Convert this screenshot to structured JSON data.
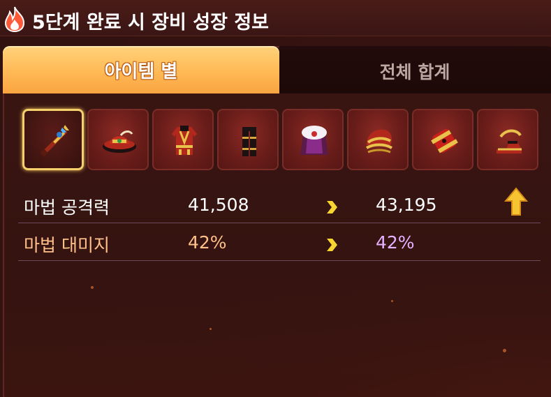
{
  "header": {
    "title": "5단계 완료 시 장비 성장 정보",
    "icon": "flame-icon"
  },
  "tabs": [
    {
      "label": "아이템 별",
      "active": true
    },
    {
      "label": "전체 합계",
      "active": false
    }
  ],
  "items": [
    {
      "icon": "staff-weapon-icon",
      "selected": true
    },
    {
      "icon": "hat-icon",
      "selected": false
    },
    {
      "icon": "overall-armor-icon",
      "selected": false
    },
    {
      "icon": "pants-icon",
      "selected": false
    },
    {
      "icon": "cape-icon",
      "selected": false
    },
    {
      "icon": "shoulder-icon",
      "selected": false
    },
    {
      "icon": "gloves-icon",
      "selected": false
    },
    {
      "icon": "shoes-icon",
      "selected": false
    }
  ],
  "stats": [
    {
      "name": "마법 공격력",
      "before": "41,508",
      "after": "43,195",
      "increased": true
    },
    {
      "name": "마법 대미지",
      "before": "42%",
      "after": "42%",
      "increased": false
    }
  ],
  "colors": {
    "tab_active": "#ffb955",
    "selected_border": "#f6d06b",
    "stat2_label": "#ffc08a",
    "stat2_after": "#e6b2ff",
    "arrow": "#f7d531"
  }
}
